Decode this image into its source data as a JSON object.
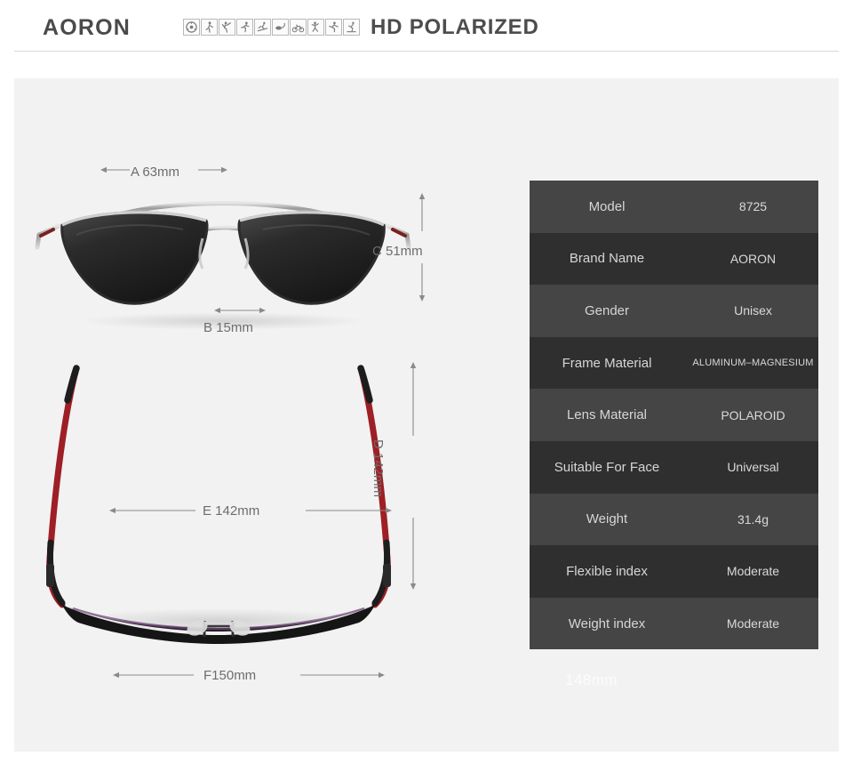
{
  "header": {
    "brand": "AORON",
    "tagline": "HD POLARIZED",
    "activity_icons": [
      "steering-wheel-icon",
      "walking-icon",
      "golf-icon",
      "running-icon",
      "skiing-icon",
      "fishing-icon",
      "cycling-icon",
      "climbing-icon",
      "soccer-icon",
      "skating-icon"
    ]
  },
  "diagrams": {
    "front_view": {
      "name": "sunglasses-front-view",
      "dimensions": {
        "a": "A 63mm",
        "b": "B 15mm",
        "c": "C 51mm"
      }
    },
    "top_view": {
      "name": "sunglasses-top-view",
      "dimensions": {
        "d": "D 142mm",
        "e": "E 142mm",
        "f": "F150mm"
      }
    }
  },
  "spec_table": {
    "rows": [
      {
        "key": "Model",
        "value": "8725"
      },
      {
        "key": "Brand Name",
        "value": "AORON"
      },
      {
        "key": "Gender",
        "value": "Unisex"
      },
      {
        "key": "Frame Material",
        "value": "ALUMINUM–MAGNESIUM"
      },
      {
        "key": "Lens Material",
        "value": "POLAROID"
      },
      {
        "key": "Suitable For Face",
        "value": "Universal"
      },
      {
        "key": "Weight",
        "value": "31.4g"
      },
      {
        "key": "Flexible index",
        "value": "Moderate"
      },
      {
        "key": "Weight index",
        "value": "Moderate"
      }
    ]
  },
  "watermark": "148mm",
  "colors": {
    "page_background": "#ffffff",
    "panel_background": "#f2f2f2",
    "row_light": "#454545",
    "row_dark": "#2f2f2f",
    "text_dark": "#4a4a4a",
    "dimension_text": "#6d6d6d"
  }
}
